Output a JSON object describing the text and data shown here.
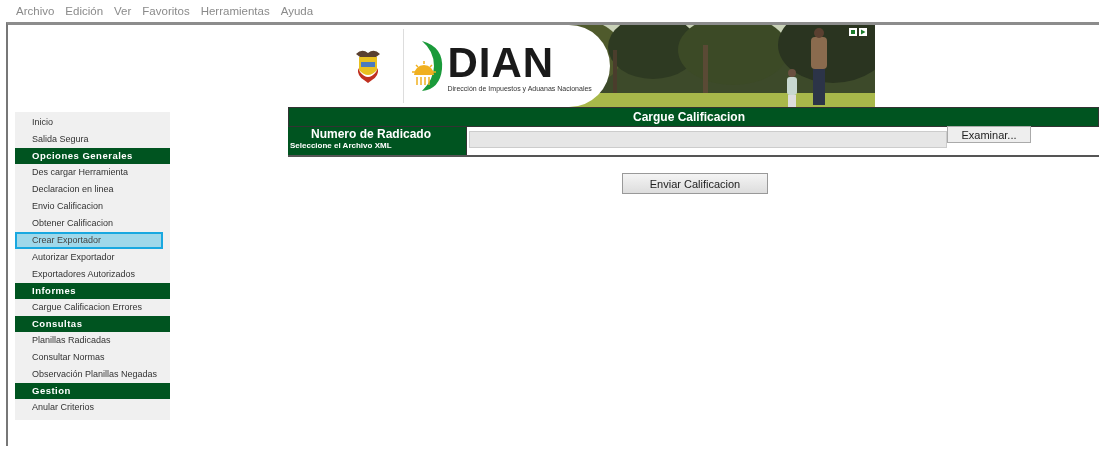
{
  "menu_bar": [
    "Archivo",
    "Edición",
    "Ver",
    "Favoritos",
    "Herramientas",
    "Ayuda"
  ],
  "banner": {
    "logo_text": "DIAN",
    "logo_subtitle": "Dirección de Impuestos y Aduanas Nacionales"
  },
  "sidebar": {
    "items": [
      {
        "kind": "link",
        "label": "Inicio",
        "selected": false
      },
      {
        "kind": "link",
        "label": "Salida Segura",
        "selected": false
      },
      {
        "kind": "header",
        "label": "Opciones Generales"
      },
      {
        "kind": "link",
        "label": "Des cargar Herramienta",
        "selected": false
      },
      {
        "kind": "link",
        "label": "Declaracion en linea",
        "selected": false
      },
      {
        "kind": "link",
        "label": "Envio Calificacion",
        "selected": false
      },
      {
        "kind": "link",
        "label": "Obtener Calificacion",
        "selected": false
      },
      {
        "kind": "link",
        "label": "Crear Exportador",
        "selected": true
      },
      {
        "kind": "link",
        "label": "Autorizar Exportador",
        "selected": false
      },
      {
        "kind": "link",
        "label": "Exportadores Autorizados",
        "selected": false
      },
      {
        "kind": "header",
        "label": "Informes"
      },
      {
        "kind": "link",
        "label": "Cargue Calificacion Errores",
        "selected": false
      },
      {
        "kind": "header",
        "label": "Consultas"
      },
      {
        "kind": "link",
        "label": "Planillas Radicadas",
        "selected": false
      },
      {
        "kind": "link",
        "label": "Consultar Normas",
        "selected": false
      },
      {
        "kind": "link",
        "label": "Observación Planillas Negadas",
        "selected": false
      },
      {
        "kind": "header",
        "label": "Gestion"
      },
      {
        "kind": "link",
        "label": "Anular Criterios",
        "selected": false
      }
    ]
  },
  "form": {
    "title": "Cargue Calificacion",
    "field_label": "Numero de Radicado",
    "field_hint": "Seleccione el Archivo XML",
    "browse_button": "Examinar...",
    "submit_button": "Enviar Calificacion"
  }
}
